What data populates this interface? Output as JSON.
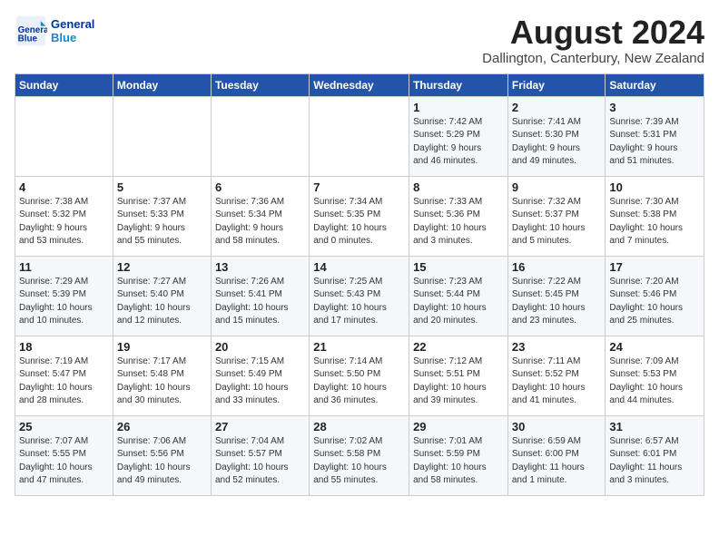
{
  "header": {
    "logo_line1": "General",
    "logo_line2": "Blue",
    "month": "August 2024",
    "location": "Dallington, Canterbury, New Zealand"
  },
  "weekdays": [
    "Sunday",
    "Monday",
    "Tuesday",
    "Wednesday",
    "Thursday",
    "Friday",
    "Saturday"
  ],
  "weeks": [
    [
      {
        "day": "",
        "info": ""
      },
      {
        "day": "",
        "info": ""
      },
      {
        "day": "",
        "info": ""
      },
      {
        "day": "",
        "info": ""
      },
      {
        "day": "1",
        "info": "Sunrise: 7:42 AM\nSunset: 5:29 PM\nDaylight: 9 hours\nand 46 minutes."
      },
      {
        "day": "2",
        "info": "Sunrise: 7:41 AM\nSunset: 5:30 PM\nDaylight: 9 hours\nand 49 minutes."
      },
      {
        "day": "3",
        "info": "Sunrise: 7:39 AM\nSunset: 5:31 PM\nDaylight: 9 hours\nand 51 minutes."
      }
    ],
    [
      {
        "day": "4",
        "info": "Sunrise: 7:38 AM\nSunset: 5:32 PM\nDaylight: 9 hours\nand 53 minutes."
      },
      {
        "day": "5",
        "info": "Sunrise: 7:37 AM\nSunset: 5:33 PM\nDaylight: 9 hours\nand 55 minutes."
      },
      {
        "day": "6",
        "info": "Sunrise: 7:36 AM\nSunset: 5:34 PM\nDaylight: 9 hours\nand 58 minutes."
      },
      {
        "day": "7",
        "info": "Sunrise: 7:34 AM\nSunset: 5:35 PM\nDaylight: 10 hours\nand 0 minutes."
      },
      {
        "day": "8",
        "info": "Sunrise: 7:33 AM\nSunset: 5:36 PM\nDaylight: 10 hours\nand 3 minutes."
      },
      {
        "day": "9",
        "info": "Sunrise: 7:32 AM\nSunset: 5:37 PM\nDaylight: 10 hours\nand 5 minutes."
      },
      {
        "day": "10",
        "info": "Sunrise: 7:30 AM\nSunset: 5:38 PM\nDaylight: 10 hours\nand 7 minutes."
      }
    ],
    [
      {
        "day": "11",
        "info": "Sunrise: 7:29 AM\nSunset: 5:39 PM\nDaylight: 10 hours\nand 10 minutes."
      },
      {
        "day": "12",
        "info": "Sunrise: 7:27 AM\nSunset: 5:40 PM\nDaylight: 10 hours\nand 12 minutes."
      },
      {
        "day": "13",
        "info": "Sunrise: 7:26 AM\nSunset: 5:41 PM\nDaylight: 10 hours\nand 15 minutes."
      },
      {
        "day": "14",
        "info": "Sunrise: 7:25 AM\nSunset: 5:43 PM\nDaylight: 10 hours\nand 17 minutes."
      },
      {
        "day": "15",
        "info": "Sunrise: 7:23 AM\nSunset: 5:44 PM\nDaylight: 10 hours\nand 20 minutes."
      },
      {
        "day": "16",
        "info": "Sunrise: 7:22 AM\nSunset: 5:45 PM\nDaylight: 10 hours\nand 23 minutes."
      },
      {
        "day": "17",
        "info": "Sunrise: 7:20 AM\nSunset: 5:46 PM\nDaylight: 10 hours\nand 25 minutes."
      }
    ],
    [
      {
        "day": "18",
        "info": "Sunrise: 7:19 AM\nSunset: 5:47 PM\nDaylight: 10 hours\nand 28 minutes."
      },
      {
        "day": "19",
        "info": "Sunrise: 7:17 AM\nSunset: 5:48 PM\nDaylight: 10 hours\nand 30 minutes."
      },
      {
        "day": "20",
        "info": "Sunrise: 7:15 AM\nSunset: 5:49 PM\nDaylight: 10 hours\nand 33 minutes."
      },
      {
        "day": "21",
        "info": "Sunrise: 7:14 AM\nSunset: 5:50 PM\nDaylight: 10 hours\nand 36 minutes."
      },
      {
        "day": "22",
        "info": "Sunrise: 7:12 AM\nSunset: 5:51 PM\nDaylight: 10 hours\nand 39 minutes."
      },
      {
        "day": "23",
        "info": "Sunrise: 7:11 AM\nSunset: 5:52 PM\nDaylight: 10 hours\nand 41 minutes."
      },
      {
        "day": "24",
        "info": "Sunrise: 7:09 AM\nSunset: 5:53 PM\nDaylight: 10 hours\nand 44 minutes."
      }
    ],
    [
      {
        "day": "25",
        "info": "Sunrise: 7:07 AM\nSunset: 5:55 PM\nDaylight: 10 hours\nand 47 minutes."
      },
      {
        "day": "26",
        "info": "Sunrise: 7:06 AM\nSunset: 5:56 PM\nDaylight: 10 hours\nand 49 minutes."
      },
      {
        "day": "27",
        "info": "Sunrise: 7:04 AM\nSunset: 5:57 PM\nDaylight: 10 hours\nand 52 minutes."
      },
      {
        "day": "28",
        "info": "Sunrise: 7:02 AM\nSunset: 5:58 PM\nDaylight: 10 hours\nand 55 minutes."
      },
      {
        "day": "29",
        "info": "Sunrise: 7:01 AM\nSunset: 5:59 PM\nDaylight: 10 hours\nand 58 minutes."
      },
      {
        "day": "30",
        "info": "Sunrise: 6:59 AM\nSunset: 6:00 PM\nDaylight: 11 hours\nand 1 minute."
      },
      {
        "day": "31",
        "info": "Sunrise: 6:57 AM\nSunset: 6:01 PM\nDaylight: 11 hours\nand 3 minutes."
      }
    ]
  ]
}
